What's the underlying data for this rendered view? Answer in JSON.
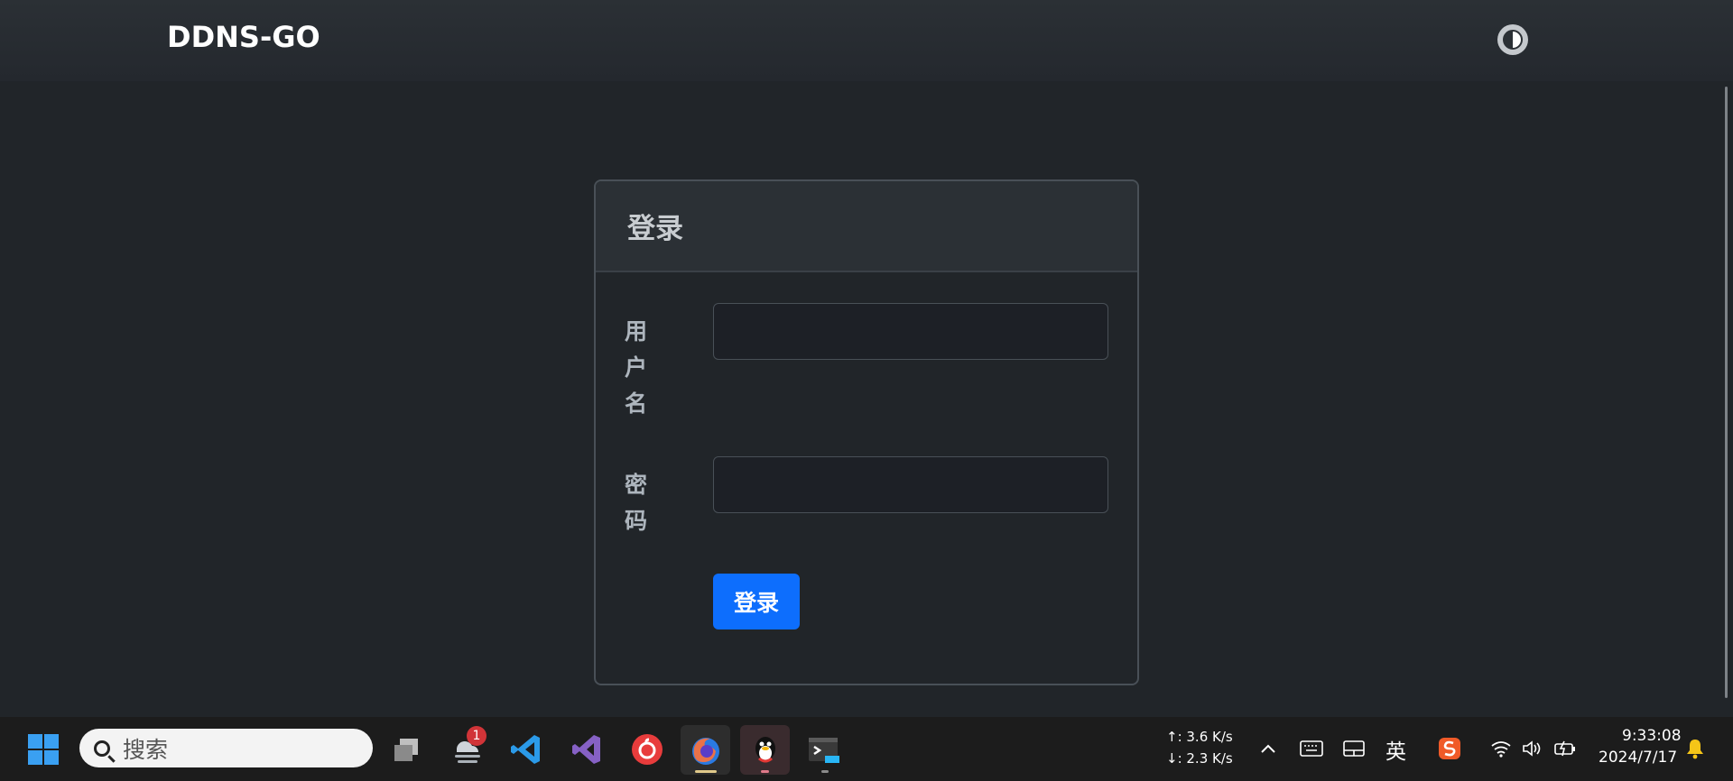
{
  "navbar": {
    "brand": "DDNS-GO",
    "theme_toggle_icon": "contrast-icon"
  },
  "login_card": {
    "title": "登录",
    "username_label": "用户名",
    "username_value": "",
    "password_label": "密码",
    "password_value": "",
    "submit_label": "登录"
  },
  "taskbar": {
    "search_placeholder": "搜索",
    "weather_badge": "1",
    "apps": [
      "windows-start-icon",
      "task-view-icon",
      "weather-icon",
      "vscode-icon",
      "visual-studio-icon",
      "netease-music-icon",
      "firefox-icon",
      "qq-icon",
      "terminal-preview-icon"
    ],
    "net_up": "↑: 3.6 K/s",
    "net_down": "↓: 2.3 K/s",
    "ime": "英",
    "time": "9:33:08",
    "date": "2024/7/17"
  }
}
